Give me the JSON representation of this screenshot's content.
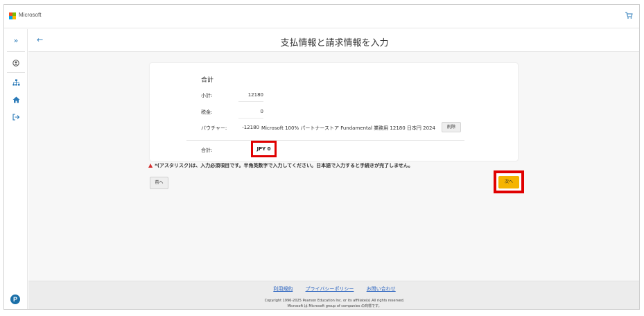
{
  "topbar": {
    "brand": "Microsoft",
    "cart_icon": "cart-icon",
    "logo_colors": [
      "#f25022",
      "#7fba00",
      "#00a4ef",
      "#ffb900"
    ]
  },
  "sidebar": {
    "icons": [
      "expand-icon",
      "user-icon",
      "sitemap-icon",
      "home-icon",
      "sign-out-icon"
    ],
    "brand_icon": "pearson-logo"
  },
  "header": {
    "title": "支払情報と請求情報を入力"
  },
  "summary": {
    "title": "合計",
    "subtotal_label": "小計:",
    "subtotal_value": "12180",
    "tax_label": "税金:",
    "tax_value": "0",
    "voucher_label": "バウチャー:",
    "voucher_value": "-12180",
    "voucher_desc": "Microsoft 100% パートナーストア Fundamental 業務用 12180 日本円 2024",
    "delete_label": "削除",
    "total_label": "合計:",
    "total_value": "JPY 0"
  },
  "warning": {
    "text": "*(アスタリスク)は、入力必須項目です。半角英数字で入力してください。日本語で入力すると手続きが完了しません。"
  },
  "nav": {
    "prev_label": "前へ",
    "next_label": "次へ"
  },
  "footer": {
    "links": [
      "利用規約",
      "プライバシーポリシー",
      "お問い合わせ"
    ],
    "copyright_line1": "Copyright 1996-2025 Pearson Education Inc. or its affiliate(s).All rights reserved.",
    "copyright_line2": "Microsoft は Microsoft group of companies の商標です。"
  },
  "colors": {
    "accent": "#2a7ab8",
    "next_button": "#f5b400",
    "highlight": "#e00000"
  }
}
